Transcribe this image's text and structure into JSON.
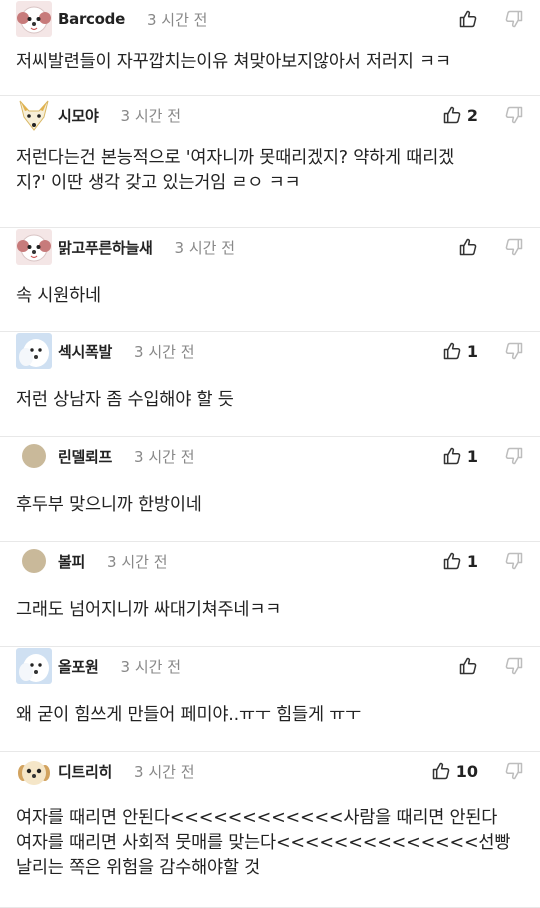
{
  "comments": [
    {
      "name": "Barcode",
      "time": "3 시간 전",
      "likes": "",
      "text": [
        "저씨발련들이 자꾸깝치는이유 쳐맞아보지않아서 저러지 ㅋㅋ"
      ],
      "avatar": "poodle-avatar"
    },
    {
      "name": "시모야",
      "time": "3 시간 전",
      "likes": "2",
      "text": [
        "저런다는건 본능적으로 '여자니까 못때리겠지? 약하게 때리겠",
        "지?' 이딴 생각 갖고 있는거임 ㄹㅇ ㅋㅋ"
      ],
      "avatar": "fox-avatar"
    },
    {
      "name": "맑고푸른하늘새",
      "time": "3 시간 전",
      "likes": "",
      "text": [
        "속 시원하네"
      ],
      "avatar": "poodle-avatar"
    },
    {
      "name": "섹시폭발",
      "time": "3 시간 전",
      "likes": "1",
      "text": [
        "저런 상남자 좀 수입해야 할 듯"
      ],
      "avatar": "white-dog-avatar"
    },
    {
      "name": "린델뢰프",
      "time": "3 시간 전",
      "likes": "1",
      "text": [
        "후두부 맞으니까 한방이네"
      ],
      "avatar": "default-avatar"
    },
    {
      "name": "볼피",
      "time": "3 시간 전",
      "likes": "1",
      "text": [
        "그래도 넘어지니까 싸대기쳐주네ㅋㅋ"
      ],
      "avatar": "default-avatar"
    },
    {
      "name": "올포원",
      "time": "3 시간 전",
      "likes": "",
      "text": [
        "왜 굳이 힘쓰게 만들어 페미야..ㅠㅜ 힘들게 ㅠㅜ"
      ],
      "avatar": "white-dog-avatar"
    },
    {
      "name": "디트리히",
      "time": "3 시간 전",
      "likes": "10",
      "text": [
        "여자를 때리면 안된다<<<<<<<<<<<<사람을 때리면 안된다",
        "여자를 때리면 사회적 뭇매를 맞는다<<<<<<<<<<<<<<선빵",
        "날리는 쪽은 위험을 감수해야할 것"
      ],
      "avatar": "puppy-avatar"
    }
  ]
}
